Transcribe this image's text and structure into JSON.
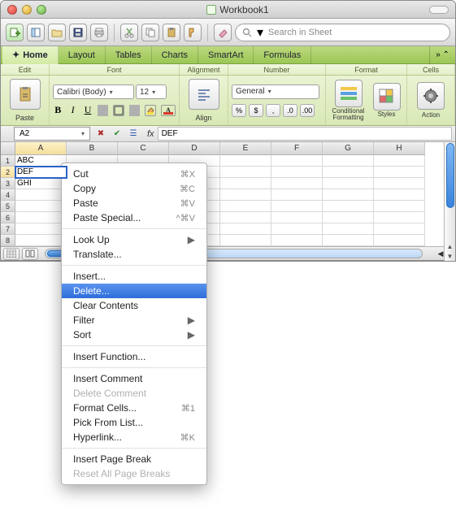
{
  "window": {
    "title": "Workbook1"
  },
  "search": {
    "placeholder": "Search in Sheet"
  },
  "ribbon": {
    "tabs": [
      "Home",
      "Layout",
      "Tables",
      "Charts",
      "SmartArt",
      "Formulas"
    ],
    "active": 0,
    "overflow": "»",
    "toggle": "⌃"
  },
  "groups": {
    "edit": "Edit",
    "font": "Font",
    "alignment": "Alignment",
    "number": "Number",
    "format": "Format",
    "cells": "Cells"
  },
  "font": {
    "name": "Calibri (Body)",
    "size": "12",
    "bold": "B",
    "italic": "I",
    "underline": "U"
  },
  "number": {
    "format": "General",
    "btns": [
      "%",
      "$",
      ",",
      ".0",
      ".00"
    ]
  },
  "big_buttons": {
    "paste": "Paste",
    "align": "Align",
    "cond_fmt1": "Conditional",
    "cond_fmt2": "Formatting",
    "styles": "Styles",
    "action": "Action"
  },
  "cell_ref": {
    "name": "A2",
    "formula": "DEF",
    "fx": "fx"
  },
  "grid": {
    "cols": [
      "A",
      "B",
      "C",
      "D",
      "E",
      "F",
      "G",
      "H"
    ],
    "rows": [
      "1",
      "2",
      "3",
      "4",
      "5",
      "6",
      "7",
      "8"
    ],
    "selected_col": 0,
    "selected_row": 1,
    "cells": {
      "A1": "ABC",
      "A2": "DEF",
      "A3": "GHI"
    }
  },
  "context_menu": {
    "groups": [
      [
        {
          "label": "Cut",
          "shortcut": "⌘X"
        },
        {
          "label": "Copy",
          "shortcut": "⌘C"
        },
        {
          "label": "Paste",
          "shortcut": "⌘V"
        },
        {
          "label": "Paste Special...",
          "shortcut": "^⌘V"
        }
      ],
      [
        {
          "label": "Look Up",
          "submenu": true
        },
        {
          "label": "Translate..."
        }
      ],
      [
        {
          "label": "Insert..."
        },
        {
          "label": "Delete...",
          "selected": true
        },
        {
          "label": "Clear Contents"
        },
        {
          "label": "Filter",
          "submenu": true
        },
        {
          "label": "Sort",
          "submenu": true
        }
      ],
      [
        {
          "label": "Insert Function..."
        }
      ],
      [
        {
          "label": "Insert Comment"
        },
        {
          "label": "Delete Comment",
          "disabled": true
        },
        {
          "label": "Format Cells...",
          "shortcut": "⌘1"
        },
        {
          "label": "Pick From List..."
        },
        {
          "label": "Hyperlink...",
          "shortcut": "⌘K"
        }
      ],
      [
        {
          "label": "Insert Page Break"
        },
        {
          "label": "Reset All Page Breaks",
          "disabled": true
        }
      ]
    ]
  }
}
